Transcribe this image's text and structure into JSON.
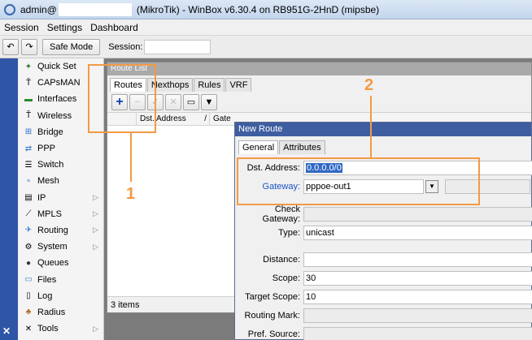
{
  "titlebar": {
    "user": "admin@",
    "title": "(MikroTik) - WinBox v6.30.4 on RB951G-2HnD (mipsbe)"
  },
  "menubar": [
    "Session",
    "Settings",
    "Dashboard"
  ],
  "toolbar": {
    "undo": "↶",
    "redo": "↷",
    "safe_mode": "Safe Mode",
    "session_label": "Session:"
  },
  "sidebar": {
    "items": [
      {
        "label": "Quick Set",
        "icon": "wand-icon",
        "submenu": false
      },
      {
        "label": "CAPsMAN",
        "icon": "antenna-icon",
        "submenu": false
      },
      {
        "label": "Interfaces",
        "icon": "interfaces-icon",
        "submenu": false
      },
      {
        "label": "Wireless",
        "icon": "antenna-icon",
        "submenu": false
      },
      {
        "label": "Bridge",
        "icon": "bridge-icon",
        "submenu": false
      },
      {
        "label": "PPP",
        "icon": "ppp-icon",
        "submenu": false
      },
      {
        "label": "Switch",
        "icon": "switch-icon",
        "submenu": false
      },
      {
        "label": "Mesh",
        "icon": "mesh-icon",
        "submenu": false
      },
      {
        "label": "IP",
        "icon": "ip-icon",
        "submenu": true
      },
      {
        "label": "MPLS",
        "icon": "mpls-icon",
        "submenu": true
      },
      {
        "label": "Routing",
        "icon": "routing-icon",
        "submenu": true
      },
      {
        "label": "System",
        "icon": "gear-icon",
        "submenu": true
      },
      {
        "label": "Queues",
        "icon": "queues-icon",
        "submenu": false
      },
      {
        "label": "Files",
        "icon": "folder-icon",
        "submenu": false
      },
      {
        "label": "Log",
        "icon": "log-icon",
        "submenu": false
      },
      {
        "label": "Radius",
        "icon": "radius-icon",
        "submenu": false
      },
      {
        "label": "Tools",
        "icon": "tools-icon",
        "submenu": true
      }
    ],
    "chevron": "▷"
  },
  "route_list": {
    "title": "Route List",
    "tabs": [
      "Routes",
      "Nexthops",
      "Rules",
      "VRF"
    ],
    "columns": [
      "Dst. Address",
      "/",
      "Gate"
    ],
    "status": "3 items"
  },
  "new_route": {
    "title": "New Route",
    "tabs": [
      "General",
      "Attributes"
    ],
    "fields": {
      "dst_address": {
        "label": "Dst. Address:",
        "value": "0.0.0.0/0"
      },
      "gateway": {
        "label": "Gateway:",
        "value": "pppoe-out1"
      },
      "check_gateway": {
        "label": "Check Gateway:",
        "value": ""
      },
      "type": {
        "label": "Type:",
        "value": "unicast"
      },
      "distance": {
        "label": "Distance:",
        "value": ""
      },
      "scope": {
        "label": "Scope:",
        "value": "30"
      },
      "target_scope": {
        "label": "Target Scope:",
        "value": "10"
      },
      "routing_mark": {
        "label": "Routing Mark:",
        "value": ""
      },
      "pref_source": {
        "label": "Pref. Source:",
        "value": ""
      }
    }
  },
  "annotations": {
    "one": "1",
    "two": "2"
  },
  "colors": {
    "annotation": "#f39a45",
    "dialog_title": "#3e5ea0",
    "sidebar_strip": "#2f55a6"
  }
}
